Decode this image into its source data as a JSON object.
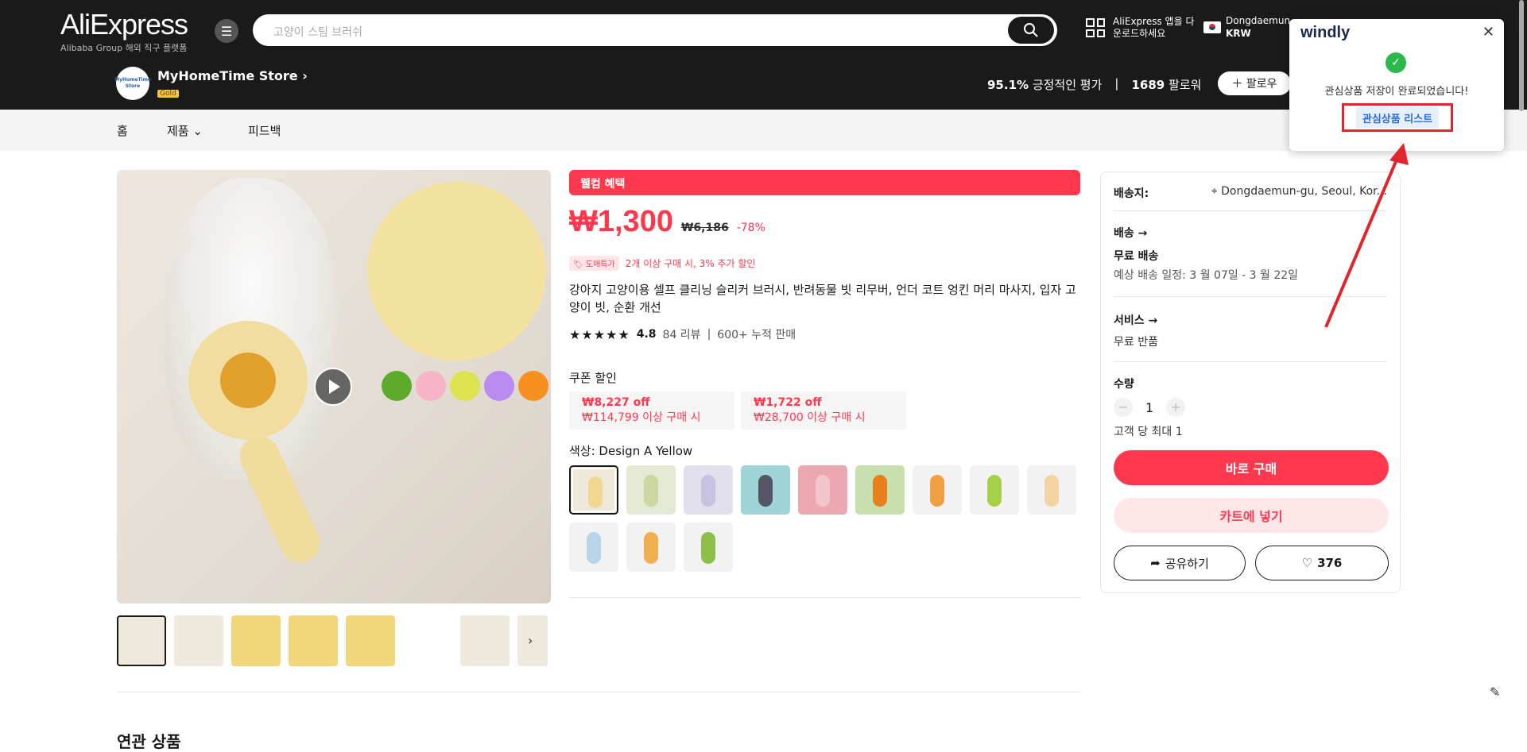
{
  "header": {
    "logo": "AliExpress",
    "logo_tagline": "Alibaba Group 해외 직구 플랫폼",
    "search_placeholder": "고양이 스팀 브러쉬",
    "app_download": "AliExpress 앱을 다운로드하세요",
    "location": "Dongdaemun-",
    "currency": "KRW"
  },
  "store": {
    "logo_text": "MyHomeTime Store",
    "name": "MyHomeTime Store",
    "badge": "Gold",
    "positive_pct": "95.1%",
    "positive_label": "긍정적인 평가",
    "followers": "1689",
    "followers_label": "팔로워",
    "follow_label": "팔로우"
  },
  "nav": {
    "home": "홈",
    "products": "제품",
    "feedback": "피드백"
  },
  "product": {
    "welcome": "웰컴 혜택",
    "price": "₩1,300",
    "original_price": "₩6,186",
    "discount": "-78%",
    "wholesale_tag": "도매특가",
    "wholesale_text": "2개 이상 구매 시, 3% 추가 할인",
    "title": "강아지 고양이용 셀프 클리닝 슬리커 브러시, 반려동물 빗 리무버, 언더 코트 엉킨 머리 마사지, 입자 고양이 빗, 순환 개선",
    "rating": "4.8",
    "reviews": "84 리뷰",
    "sold": "600+ 누적 판매",
    "coupon_label": "쿠폰 할인",
    "coupons": [
      {
        "off": "₩8,227 off",
        "cond": "₩114,799 이상 구매 시"
      },
      {
        "off": "₩1,722 off",
        "cond": "₩28,700 이상 구매 시"
      }
    ],
    "color_label": "색상: Design A Yellow",
    "related": "연관 상품"
  },
  "sidebar": {
    "ship_to_label": "배송지:",
    "ship_to": "Dongdaemun-gu, Seoul, Kor...",
    "shipping_label": "배송 →",
    "free_shipping": "무료 배송",
    "eta": "예상 배송 일정: 3 월 07일 - 3 월 22일",
    "service_label": "서비스 →",
    "free_return": "무료 반품",
    "qty_label": "수량",
    "qty": "1",
    "max_per_customer": "고객 당 최대 1",
    "buy_now": "바로 구매",
    "add_to_cart": "카트에 넣기",
    "share": "공유하기",
    "likes": "376"
  },
  "popup": {
    "brand": "windly",
    "message": "관심상품 저장이 완료되었습니다!",
    "list_button": "관심상품 리스트"
  },
  "colors": {
    "accent": "#fd384f",
    "dark": "#1a1a1a",
    "highlight": "#e0262c"
  }
}
